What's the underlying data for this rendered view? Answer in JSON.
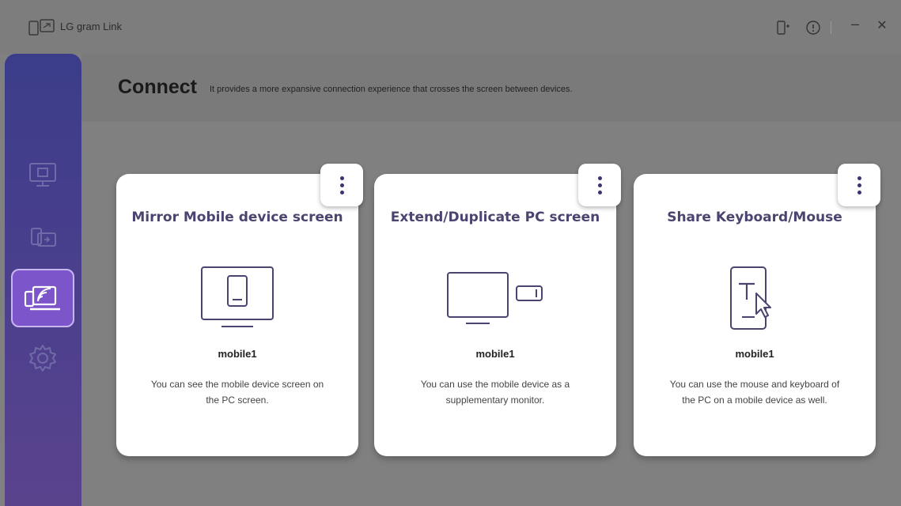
{
  "window": {
    "title": "LG gram Link",
    "logo_icon": "lg-gram-link-logo-icon"
  },
  "titlebar": {
    "icons": [
      "device-connect-icon",
      "info-icon",
      "minimize-icon",
      "close-icon"
    ],
    "minimize_label": "–",
    "close_label": "✕"
  },
  "sidebar": {
    "items": [
      {
        "icon": "screen-share-icon",
        "active": false
      },
      {
        "icon": "extend-screen-icon",
        "active": false
      },
      {
        "icon": "connect-icon",
        "active": true
      },
      {
        "icon": "settings-icon",
        "active": false
      }
    ]
  },
  "header": {
    "title": "Connect",
    "subtitle": "It provides a more expansive connection experience that crosses the screen between devices."
  },
  "cards": [
    {
      "title": "Mirror Mobile device screen",
      "icon": "mirror-screen-icon",
      "device": "mobile1",
      "desc_line1": "You can see the mobile device screen on",
      "desc_line2": "the PC screen."
    },
    {
      "title": "Extend/Duplicate PC screen",
      "icon": "extend-duplicate-icon",
      "device": "mobile1",
      "desc_line1": "You can use the mobile device as a",
      "desc_line2": "supplementary monitor."
    },
    {
      "title": "Share Keyboard/Mouse",
      "icon": "keyboard-mouse-icon",
      "device": "mobile1",
      "desc_line1": "You can use the mouse and keyboard of",
      "desc_line2": "the PC on a mobile device as well."
    }
  ],
  "colors": {
    "accent": "#7b55c9",
    "sidebar_top": "#3b3d8a",
    "card_title": "#4b4470"
  }
}
